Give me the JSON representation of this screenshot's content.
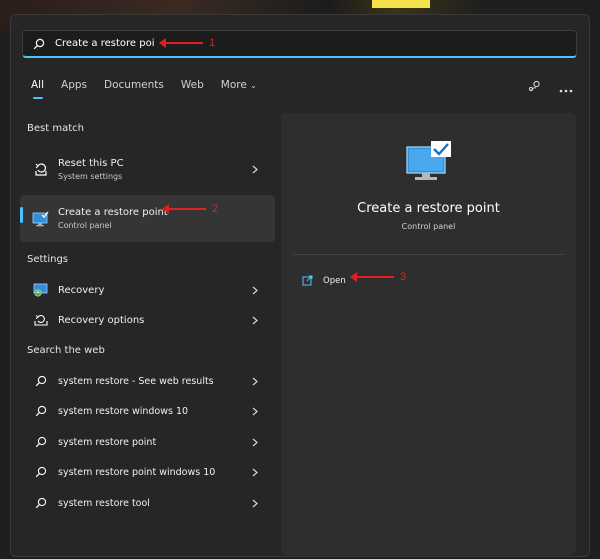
{
  "search": {
    "value": "Create a restore point"
  },
  "annotations": {
    "step1": "1",
    "step2": "2",
    "step3": "3"
  },
  "tabs": [
    {
      "label": "All",
      "active": true
    },
    {
      "label": "Apps"
    },
    {
      "label": "Documents"
    },
    {
      "label": "Web"
    },
    {
      "label": "More"
    }
  ],
  "sections": {
    "best_match": "Best match",
    "settings": "Settings",
    "search_web": "Search the web"
  },
  "best_match": [
    {
      "label": "Reset this PC",
      "sub": "System settings",
      "icon": "reset-pc-icon"
    },
    {
      "label": "Create a restore point",
      "sub": "Control panel",
      "icon": "system-properties-icon"
    }
  ],
  "settings": [
    {
      "label": "Recovery",
      "icon": "recovery-icon"
    },
    {
      "label": "Recovery options",
      "icon": "recovery-options-icon"
    }
  ],
  "web": [
    {
      "label": "system restore - See web results"
    },
    {
      "label": "system restore windows 10"
    },
    {
      "label": "system restore point"
    },
    {
      "label": "system restore point windows 10"
    },
    {
      "label": "system restore tool"
    }
  ],
  "preview": {
    "title": "Create a restore point",
    "subtitle": "Control panel",
    "open_label": "Open"
  },
  "colors": {
    "accent": "#4cc2ff",
    "annotation": "#e02020"
  }
}
